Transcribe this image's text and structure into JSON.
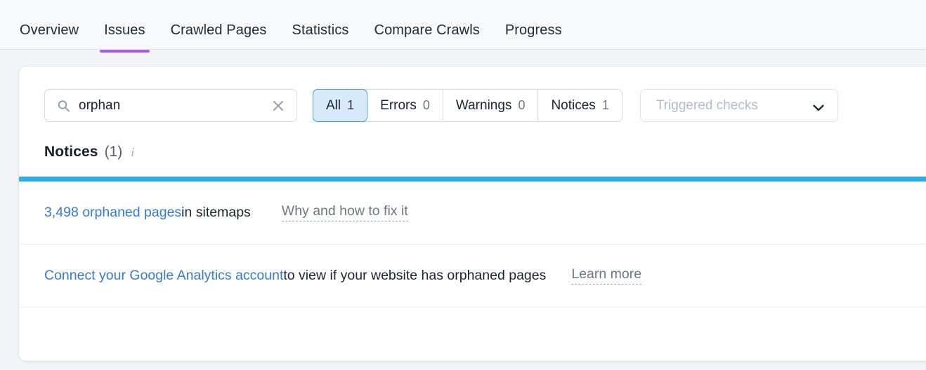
{
  "tabs": [
    {
      "label": "Overview",
      "active": false
    },
    {
      "label": "Issues",
      "active": true
    },
    {
      "label": "Crawled Pages",
      "active": false
    },
    {
      "label": "Statistics",
      "active": false
    },
    {
      "label": "Compare Crawls",
      "active": false
    },
    {
      "label": "Progress",
      "active": false
    }
  ],
  "search": {
    "value": "orphan",
    "placeholder": "Search",
    "icon": "search-icon",
    "clear_icon": "close-icon"
  },
  "filters": [
    {
      "label": "All",
      "count": "1",
      "active": true
    },
    {
      "label": "Errors",
      "count": "0",
      "active": false
    },
    {
      "label": "Warnings",
      "count": "0",
      "active": false
    },
    {
      "label": "Notices",
      "count": "1",
      "active": false
    }
  ],
  "dropdown": {
    "label": "Triggered checks",
    "icon": "chevron-down-icon"
  },
  "section": {
    "title": "Notices",
    "count": "(1)",
    "info_icon": "i"
  },
  "issues": [
    {
      "link": "3,498 orphaned pages",
      "text": " in sitemaps",
      "helper": "Why and how to fix it"
    },
    {
      "link": "Connect your Google Analytics account",
      "text": " to view if your website has orphaned pages",
      "helper": "Learn more"
    }
  ],
  "colors": {
    "page_bg": "#f3f4f7",
    "tab_bg": "#f7f8fa",
    "accent_purple": "#ab5ef5",
    "accent_blue_bar": "#2bacec",
    "link_blue": "#337ccf",
    "segment_active_bg": "#d8e9fa",
    "segment_active_border": "#4b9ae6"
  }
}
